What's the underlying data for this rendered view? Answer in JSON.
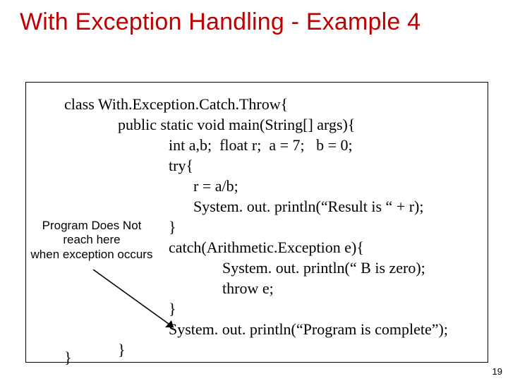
{
  "title": "With Exception Handling  - Example 4",
  "page_number": "19",
  "annotation": {
    "line1": "Program Does Not",
    "line2": "reach here",
    "line3": "when exception occurs"
  },
  "code": {
    "l1": "class With.Exception.Catch.Throw{",
    "l2": "public static void main(String[] args){",
    "l3": "int a,b;  float r;  a = 7;   b = 0;",
    "l4": "try{",
    "l5": "r = a/b;",
    "l6": "System. out. println(“Result is “ + r);",
    "l7": "}",
    "l8": "catch(Arithmetic.Exception e){",
    "l9": "System. out. println(“ B is zero);",
    "l10": "throw e;",
    "l11": "}",
    "l12": "System. out. println(“Program is complete”);",
    "l13": "}",
    "l14": "}"
  }
}
